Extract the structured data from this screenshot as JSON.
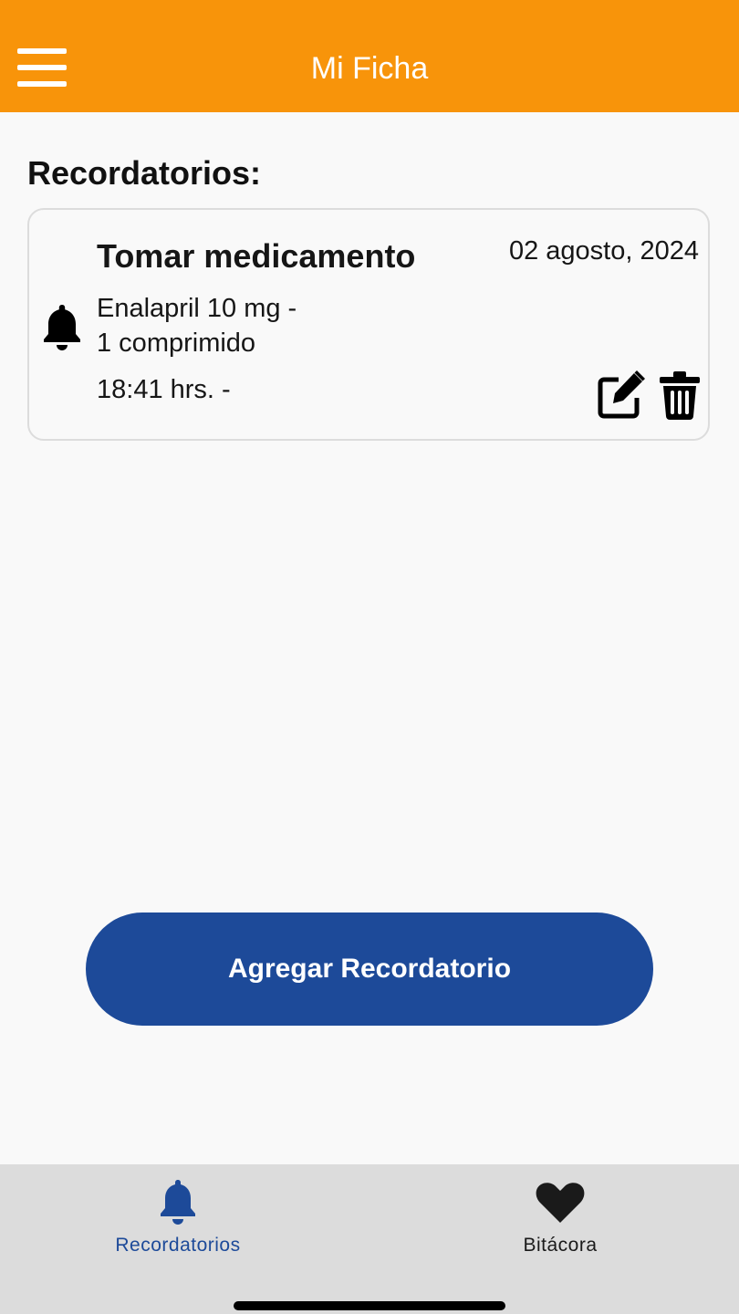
{
  "header": {
    "title": "Mi Ficha",
    "background": "#f8940a",
    "menu_icon": "hamburger-menu-icon"
  },
  "section": {
    "title": "Recordatorios:"
  },
  "reminders": [
    {
      "title": "Tomar medicamento",
      "date": "02 agosto, 2024",
      "medication": "Enalapril 10 mg -",
      "dose": "1 comprimido",
      "time": "18:41 hrs. -",
      "icon": "bell-icon",
      "actions": [
        "edit-icon",
        "trash-icon"
      ]
    }
  ],
  "add_button": {
    "label": "Agregar Recordatorio",
    "color": "#1d4a99"
  },
  "tabbar": {
    "tabs": [
      {
        "label": "Recordatorios",
        "icon": "bell-icon",
        "active": true,
        "color": "#1d4a99"
      },
      {
        "label": "Bitácora",
        "icon": "heart-icon",
        "active": false,
        "color": "#1a1a1a"
      }
    ]
  }
}
